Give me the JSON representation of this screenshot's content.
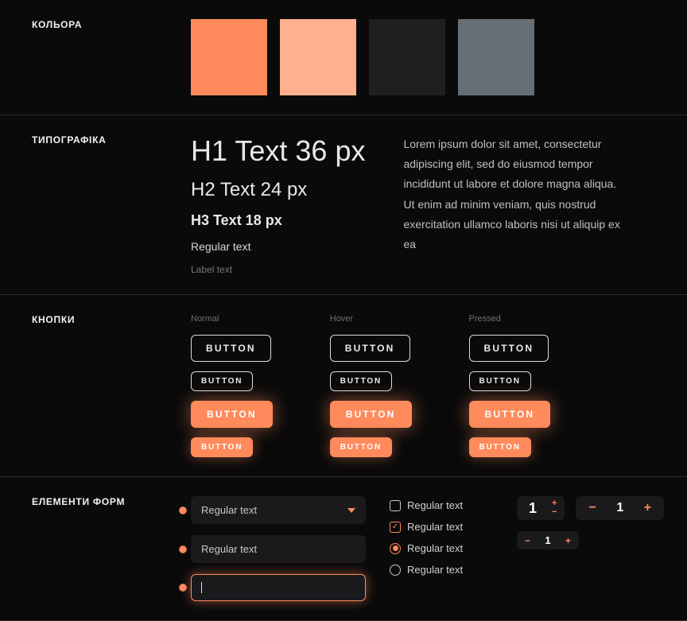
{
  "sections": {
    "colors": {
      "label": "КОЛЬОРА"
    },
    "typography": {
      "label": "ТИПОГРАФІКА"
    },
    "buttons": {
      "label": "КНОПКИ"
    },
    "forms": {
      "label": "ЕЛЕМЕНТИ ФОРМ"
    }
  },
  "palette": {
    "accent": "#ff8a5b",
    "accent_light": "#ffb08e",
    "gray_dark": "#1f1f22",
    "gray_blue": "#676e74"
  },
  "typography": {
    "h1": "H1 Text 36 px",
    "h2": "H2 Text 24 px",
    "h3": "H3 Text 18 px",
    "regular": "Regular text",
    "label": "Label text",
    "lorem": "Lorem ipsum dolor sit amet, consectetur adipiscing elit, sed do eiusmod tempor incididunt ut labore et dolore magna aliqua. Ut enim ad minim veniam, quis nostrud exercitation ullamco laboris nisi ut aliquip ex ea"
  },
  "buttons": {
    "states": {
      "normal": "Normal",
      "hover": "Hover",
      "pressed": "Pressed"
    },
    "label": "BUTTON"
  },
  "forms": {
    "select_value": "Regular text",
    "input_value": "Regular text",
    "input_focus_value": "",
    "checkbox_unchecked": "Regular text",
    "checkbox_checked": "Regular text",
    "radio_checked": "Regular text",
    "radio_unchecked": "Regular text",
    "stepper_a": "1",
    "stepper_b": "1",
    "stepper_c": "1",
    "plus": "+",
    "minus": "−"
  }
}
